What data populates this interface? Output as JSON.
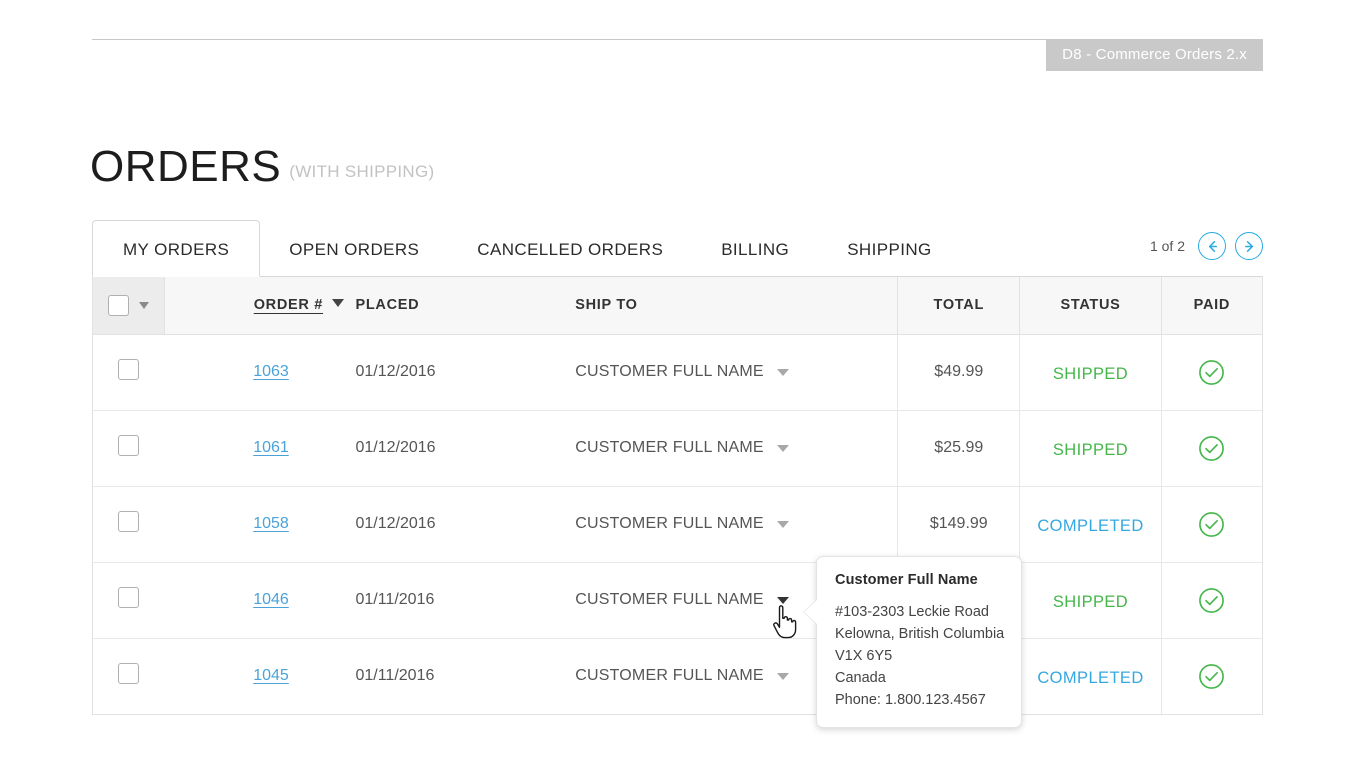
{
  "ribbon": {
    "label": "D8 - Commerce Orders 2.x"
  },
  "heading": {
    "main": "ORDERS",
    "sub": "(WITH SHIPPING)"
  },
  "tabs": [
    {
      "label": "MY ORDERS",
      "active": true
    },
    {
      "label": "OPEN ORDERS",
      "active": false
    },
    {
      "label": "CANCELLED ORDERS",
      "active": false
    },
    {
      "label": "BILLING",
      "active": false
    },
    {
      "label": "SHIPPING",
      "active": false
    }
  ],
  "pagination": {
    "label": "1 of 2",
    "current_page": 1,
    "total_pages": 2,
    "prev_icon": "arrow-left-circle-icon",
    "next_icon": "arrow-right-circle-icon",
    "accent_color": "#29abe2"
  },
  "table": {
    "headers": {
      "select_all": "",
      "order": "ORDER #",
      "placed": "PLACED",
      "ship_to": "SHIP TO",
      "total": "TOTAL",
      "status": "STATUS",
      "paid": "PAID"
    },
    "sort": {
      "column": "ORDER #",
      "direction": "desc"
    },
    "rows": [
      {
        "order": "1063",
        "placed": "01/12/2016",
        "ship_to": "CUSTOMER FULL NAME",
        "total": "$49.99",
        "status": "SHIPPED",
        "status_kind": "shipped",
        "paid": "paid-check-icon",
        "caret_active": false
      },
      {
        "order": "1061",
        "placed": "01/12/2016",
        "ship_to": "CUSTOMER FULL NAME",
        "total": "$25.99",
        "status": "SHIPPED",
        "status_kind": "shipped",
        "paid": "paid-check-icon",
        "caret_active": false
      },
      {
        "order": "1058",
        "placed": "01/12/2016",
        "ship_to": "CUSTOMER FULL NAME",
        "total": "$149.99",
        "status": "COMPLETED",
        "status_kind": "completed",
        "paid": "paid-check-icon",
        "caret_active": false
      },
      {
        "order": "1046",
        "placed": "01/11/2016",
        "ship_to": "CUSTOMER FULL NAME",
        "total": "",
        "status": "SHIPPED",
        "status_kind": "shipped",
        "paid": "paid-check-icon",
        "caret_active": true
      },
      {
        "order": "1045",
        "placed": "01/11/2016",
        "ship_to": "CUSTOMER FULL NAME",
        "total": "",
        "status": "COMPLETED",
        "status_kind": "completed",
        "paid": "paid-check-icon",
        "caret_active": false
      }
    ]
  },
  "tooltip": {
    "title": "Customer Full Name",
    "lines": [
      "#103-2303 Leckie Road",
      "Kelowna, British Columbia",
      "V1X 6Y5",
      "Canada",
      "Phone: 1.800.123.4567"
    ]
  },
  "colors": {
    "link": "#4aa3d8",
    "status_shipped": "#45b64a",
    "status_completed": "#35a8e0",
    "paid_icon": "#45b64a",
    "ribbon_bg": "#c9c9c9"
  }
}
